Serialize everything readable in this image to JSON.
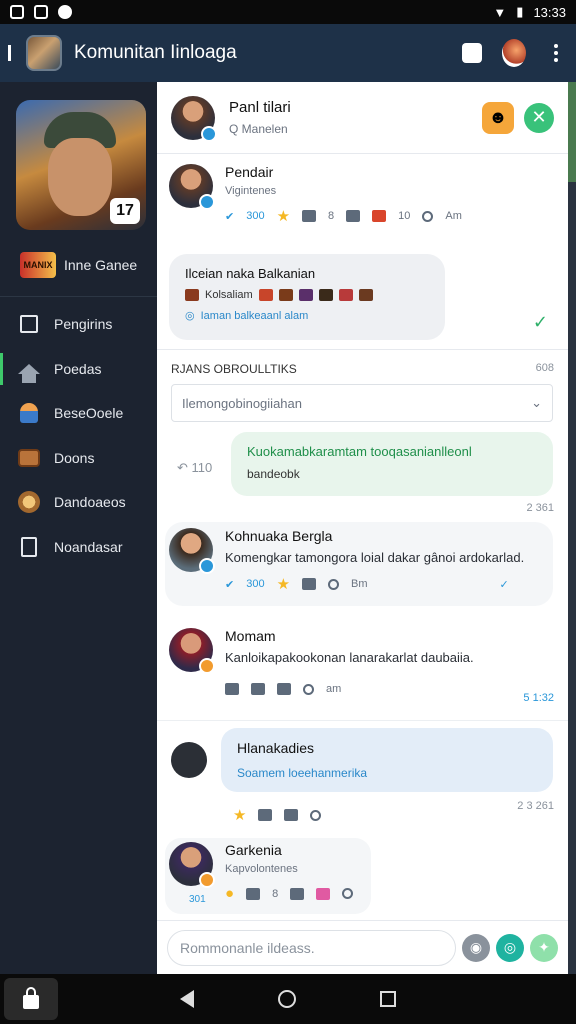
{
  "status": {
    "time": "13:33"
  },
  "appbar": {
    "title": "Komunitan Iinloaga",
    "back_icon": "back-icon",
    "actions": [
      "calendar-icon",
      "rocket-icon",
      "more-vert-icon"
    ]
  },
  "sidebar": {
    "game_badge": "17",
    "game_logo_text": "MANIX",
    "game_name": "Inne Ganee",
    "items": [
      {
        "label": "Pengirins",
        "icon": "flag-icon"
      },
      {
        "label": "Poedas",
        "icon": "home-icon"
      },
      {
        "label": "BeseOoele",
        "icon": "person-icon"
      },
      {
        "label": "Doons",
        "icon": "chest-icon"
      },
      {
        "label": "Dandoaeos",
        "icon": "sword-icon"
      },
      {
        "label": "Noandasar",
        "icon": "doc-icon"
      }
    ]
  },
  "chat": {
    "header": {
      "name": "Panl tilari",
      "sub": "Q  Manelen"
    },
    "post1": {
      "name": "Pendair",
      "sub": "Vigintenes",
      "stats": [
        "300",
        "8",
        "10",
        "Am"
      ]
    },
    "bubble_grey": {
      "title": "Ilceian naka Balkanian",
      "items_label": "Kolsaliam",
      "link": "Iaman balkeaanl alam"
    },
    "section": {
      "title": "RJANS OBROULLTIKS",
      "right": "608"
    },
    "dropdown": {
      "value": "Ilemongobinogiiahan"
    },
    "reply_count": "110",
    "bubble_green": {
      "title": "Kuokamabkaramtam tooqasanianlleonl",
      "sub": "bandeobk",
      "stamp": "2 361"
    },
    "post2": {
      "name": "Kohnuaka Bergla",
      "text": "Komengkar tamongora loial dakar gânoi ardokarlad.",
      "stats": [
        "300",
        "Bm"
      ]
    },
    "post3": {
      "name": "Momam",
      "text": "Kanloikapakookonan lanarakarlat daubaiia.",
      "stats": [
        "am"
      ],
      "stamp": "5 1:32"
    },
    "bubble_blue": {
      "title": "Hlanakadies",
      "sub": "Soamem loeehanmerika",
      "stamp": "2 3 261"
    },
    "post4": {
      "name": "Garkenia",
      "sub": "Kapvolontenes",
      "stats": [
        "301",
        "8"
      ]
    },
    "composer": {
      "placeholder": "Rommonanle ildeass."
    }
  },
  "colors": {
    "accent_green": "#39c27a",
    "appbar": "#1e3148",
    "sidebar": "#1c2330",
    "link_blue": "#2a88c9"
  }
}
